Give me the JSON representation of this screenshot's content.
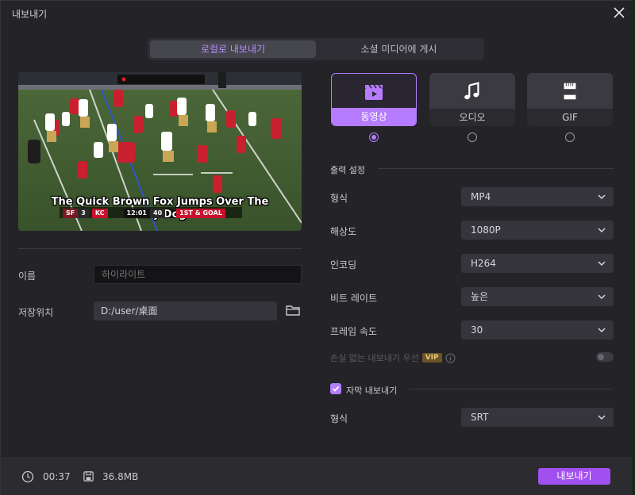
{
  "window": {
    "title": "내보내기"
  },
  "segments": [
    {
      "label": "로컬로 내보내기"
    },
    {
      "label": "소셜 미디어에 게시"
    }
  ],
  "preview": {
    "caption_line1": "The Quick Brown Fox Jumps Over The",
    "caption_line2": "Lazy Dog",
    "scorebug": {
      "team1": "SF",
      "score1": "3",
      "team2": "KC",
      "clock": "12:01",
      "play_clock": "40",
      "down": "1ST & GOAL"
    }
  },
  "left_form": {
    "name_label": "이름",
    "name_placeholder": "하이라이트",
    "location_label": "저장위치",
    "location_value": "D:/user/桌面"
  },
  "types": [
    {
      "label": "동영상",
      "icon": "video-clapper-icon",
      "selected": true
    },
    {
      "label": "오디오",
      "icon": "music-note-icon",
      "selected": false
    },
    {
      "label": "GIF",
      "icon": "gif-icon",
      "selected": false
    }
  ],
  "output_settings": {
    "title": "출력 설정",
    "rows": [
      {
        "label": "형식",
        "value": "MP4"
      },
      {
        "label": "해상도",
        "value": "1080P"
      },
      {
        "label": "인코딩",
        "value": "H264"
      },
      {
        "label": "비트 레이트",
        "value": "높은"
      },
      {
        "label": "프레임 속도",
        "value": "30"
      }
    ],
    "lossless_label": "손실 없는 내보내기 우선",
    "vip_badge": "VIP"
  },
  "subtitle_export": {
    "checkbox_label": "자막 내보내기",
    "checked": true,
    "format_label": "형식",
    "format_value": "SRT"
  },
  "footer": {
    "duration": "00:37",
    "size": "36.8MB",
    "export_label": "내보내기"
  },
  "colors": {
    "accent": "#b57cff",
    "button": "#a24ff0",
    "background": "#232328"
  }
}
